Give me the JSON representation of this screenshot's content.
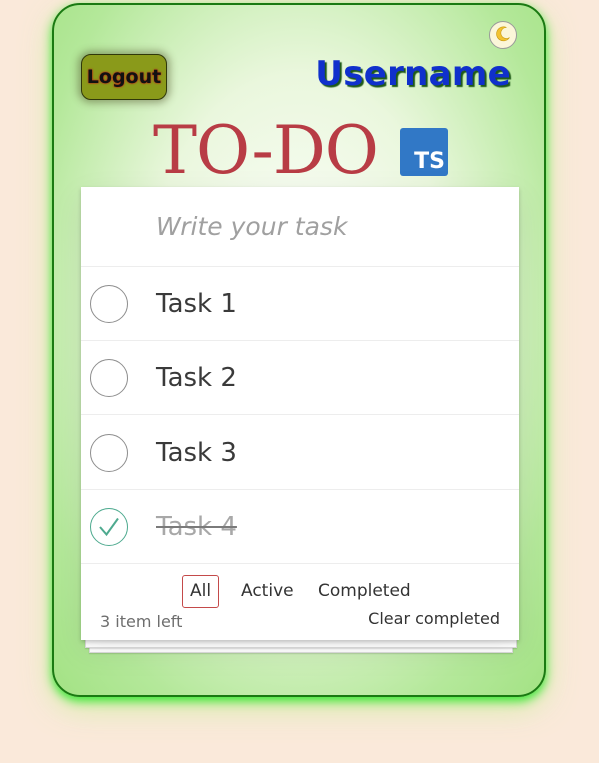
{
  "header": {
    "theme_icon": "moon-icon",
    "logout_label": "Logout",
    "username": "Username",
    "title": "TO-DO",
    "ts_badge": "TS"
  },
  "input": {
    "placeholder": "Write your task",
    "value": ""
  },
  "todos": [
    {
      "label": "Task 1",
      "completed": false
    },
    {
      "label": "Task 2",
      "completed": false
    },
    {
      "label": "Task 3",
      "completed": false
    },
    {
      "label": "Task 4",
      "completed": true
    }
  ],
  "footer": {
    "items_left": "3 item left",
    "filters": [
      {
        "label": "All",
        "selected": true
      },
      {
        "label": "Active",
        "selected": false
      },
      {
        "label": "Completed",
        "selected": false
      }
    ],
    "clear_completed": "Clear completed"
  },
  "colors": {
    "background": "#fae9da",
    "card_border": "#1a7a12",
    "title": "#b83c45",
    "username": "#1030cc",
    "ts_badge": "#3178c6",
    "logout_button": "#8a9a1a",
    "check_done": "#4eaa8f",
    "filter_selected_border": "#c44a4a"
  }
}
